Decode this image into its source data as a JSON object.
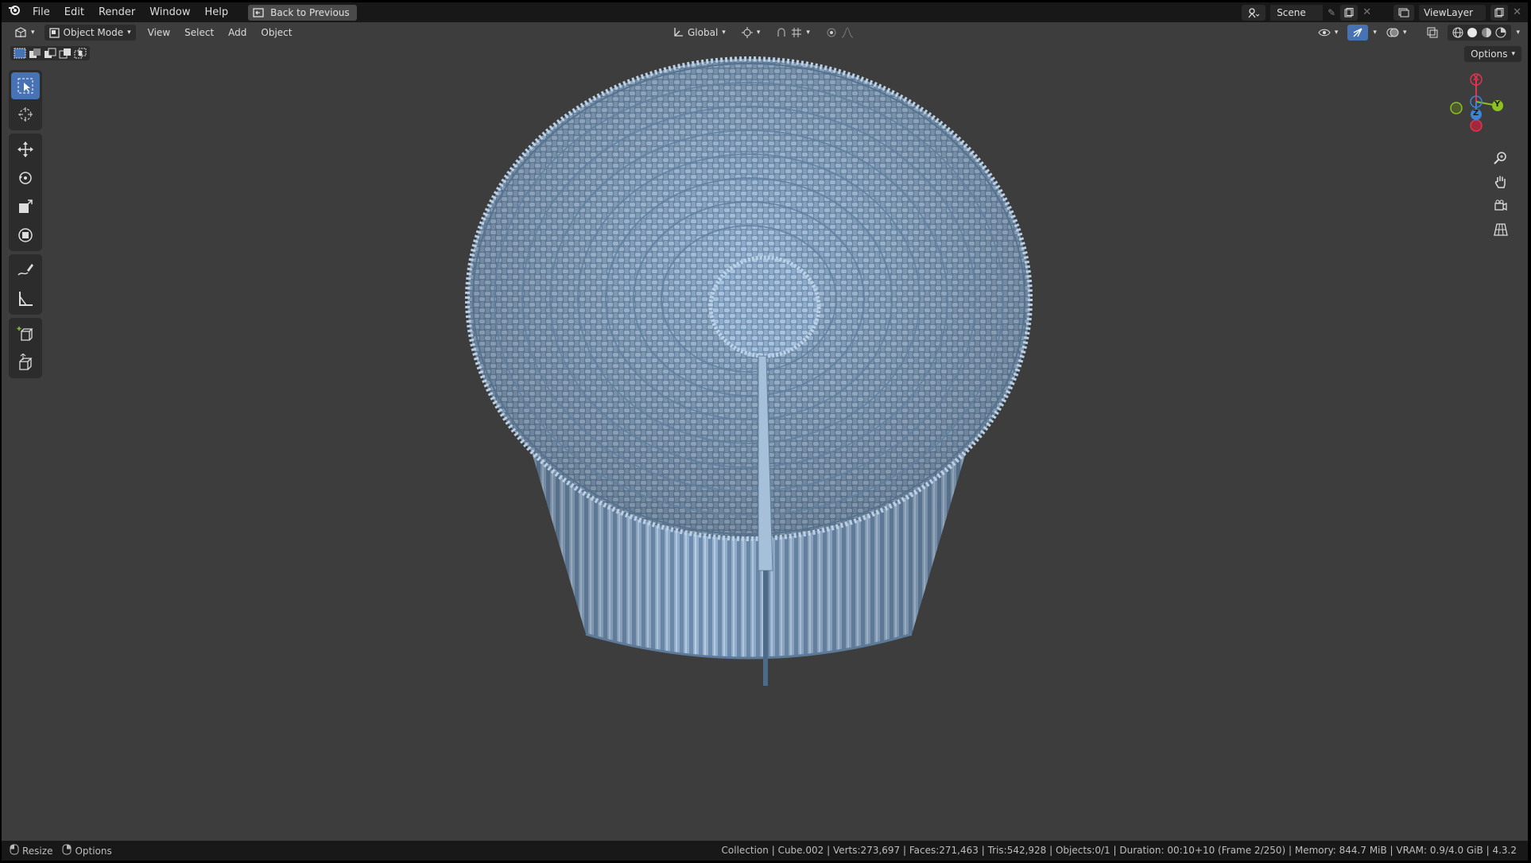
{
  "topbar": {
    "menus": [
      "File",
      "Edit",
      "Render",
      "Window",
      "Help"
    ],
    "back_button": "Back to Previous",
    "scene_name": "Scene",
    "view_layer": "ViewLayer"
  },
  "viewport_header": {
    "mode": "Object Mode",
    "menus": [
      "View",
      "Select",
      "Add",
      "Object"
    ],
    "transform_orientation": "Global",
    "options": "Options"
  },
  "gizmo": {
    "x_label": "X",
    "y_label": "Y",
    "z_label": "Z"
  },
  "statusbar": {
    "left_items": [
      "Resize",
      "Options"
    ],
    "info": "Collection | Cube.002 | Verts:273,697 | Faces:271,463 | Tris:542,928 | Objects:0/1 | Duration: 00:10+10 (Frame 2/250) | Memory: 844.7 MiB | VRAM: 0.9/4.0 GiB | 4.3.2"
  },
  "colors": {
    "accent": "#4772b3",
    "viewport_bg": "#3d3d3d",
    "object_color": "#7f9dbd",
    "axis_x": "#e0344f",
    "axis_y": "#8bc21f",
    "axis_z": "#3b84d6"
  },
  "tools": [
    "select-box-icon",
    "cursor-icon",
    "move-icon",
    "rotate-icon",
    "scale-icon",
    "transform-icon",
    "annotate-icon",
    "measure-icon",
    "add-cube-icon",
    "extrude-icon"
  ]
}
